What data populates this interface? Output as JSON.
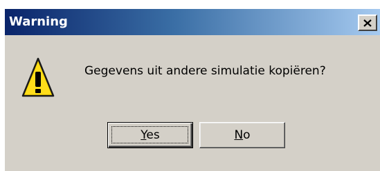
{
  "window": {
    "title": "Warning",
    "close_icon": "close-icon"
  },
  "message": {
    "icon": "warning-triangle-icon",
    "text": "Gegevens uit andere simulatie kopiëren?"
  },
  "buttons": {
    "yes": {
      "mnemonic": "Y",
      "rest": "es"
    },
    "no": {
      "mnemonic": "N",
      "rest": "o"
    }
  },
  "colors": {
    "titlebar_start": "#0a246a",
    "titlebar_end": "#a6caf0",
    "dialog_bg": "#d4d0c8",
    "warning_fill": "#ffd800"
  }
}
